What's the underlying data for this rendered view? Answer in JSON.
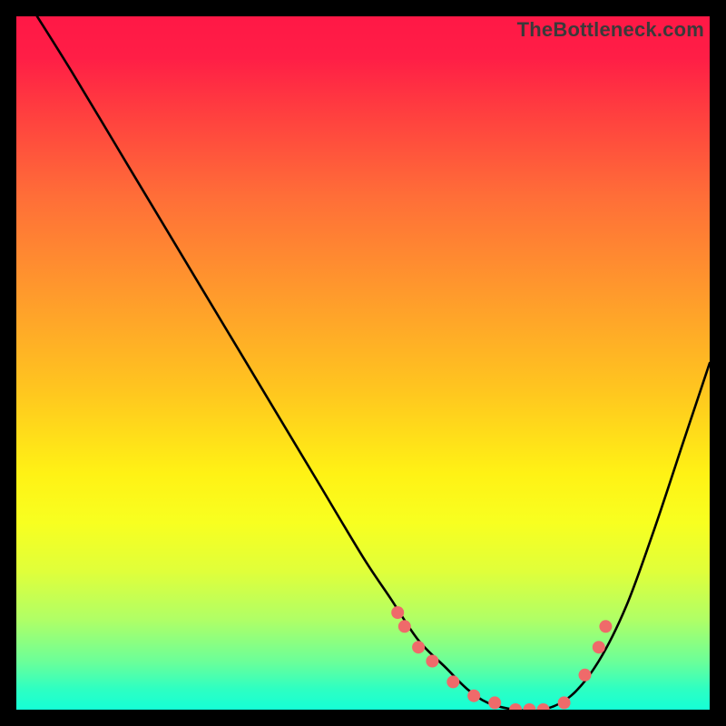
{
  "watermark": "TheBottleneck.com",
  "chart_data": {
    "type": "line",
    "title": "",
    "xlabel": "",
    "ylabel": "",
    "xlim": [
      0,
      100
    ],
    "ylim": [
      0,
      100
    ],
    "grid": false,
    "curve": {
      "x": [
        3,
        8,
        14,
        20,
        26,
        32,
        38,
        44,
        50,
        54,
        58,
        62,
        65,
        68,
        72,
        76,
        80,
        84,
        88,
        92,
        96,
        100
      ],
      "y": [
        100,
        92,
        82,
        72,
        62,
        52,
        42,
        32,
        22,
        16,
        10,
        6,
        3,
        1,
        0,
        0,
        2,
        7,
        15,
        26,
        38,
        50
      ]
    },
    "markers": {
      "x": [
        55,
        56,
        58,
        60,
        63,
        66,
        69,
        72,
        74,
        76,
        79,
        82,
        84,
        85
      ],
      "y": [
        14,
        12,
        9,
        7,
        4,
        2,
        1,
        0,
        0,
        0,
        1,
        5,
        9,
        12
      ],
      "color": "#ef6a6a",
      "radius": 7
    },
    "gradient_stops": [
      {
        "pos": 0,
        "color": "#ff1846"
      },
      {
        "pos": 50,
        "color": "#ffdc1a"
      },
      {
        "pos": 100,
        "color": "#15ffd6"
      }
    ]
  }
}
